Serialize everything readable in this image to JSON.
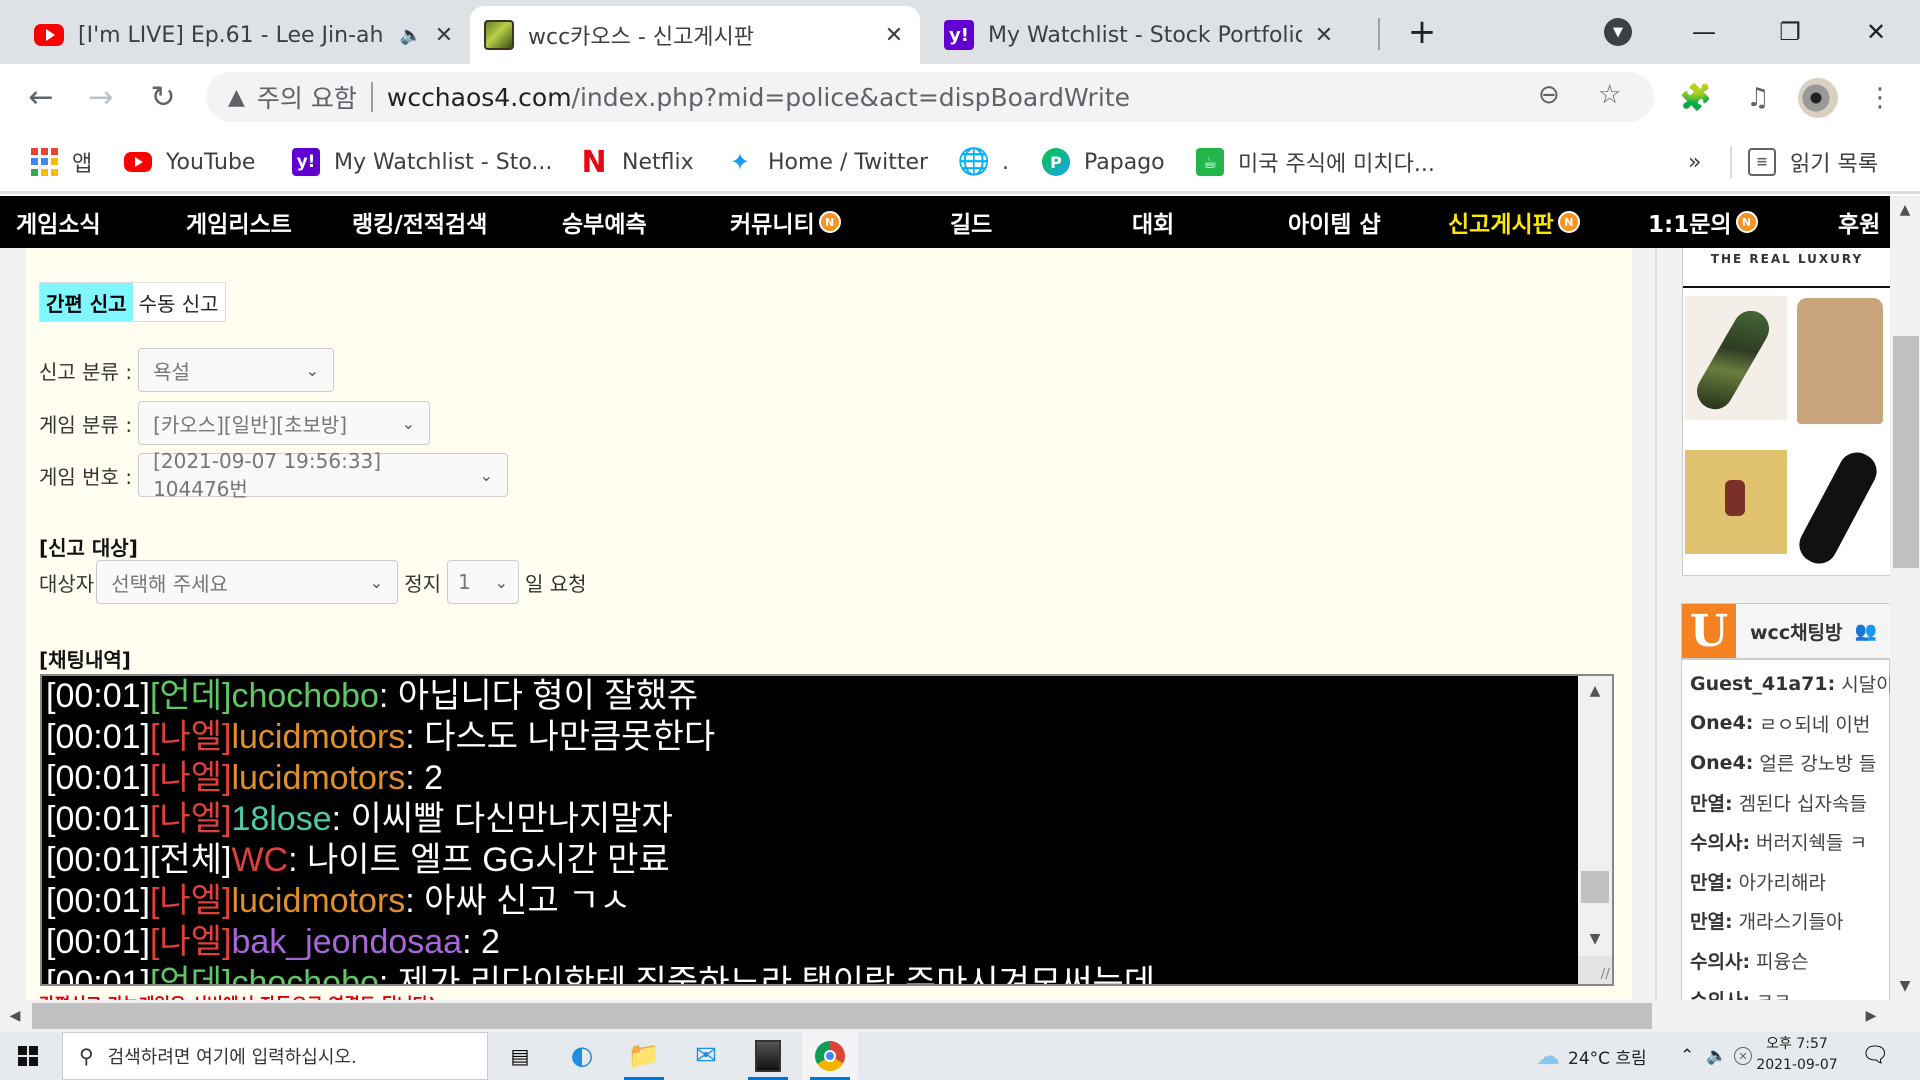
{
  "browser": {
    "tabs": [
      {
        "title": "[I'm LIVE] Ep.61 - Lee Jin-ah",
        "favicon": "youtube-icon",
        "audio": true,
        "active": false
      },
      {
        "title": "wcc카오스 - 신고게시판",
        "favicon": "orc-icon",
        "active": true
      },
      {
        "title": "My Watchlist - Stock Portfolio &",
        "favicon": "yahoo-icon",
        "active": false
      }
    ],
    "new_tab_label": "+",
    "address": {
      "security_label": "주의 요함",
      "host": "wcchaos4.com",
      "path": "/index.php?mid=police&act=dispBoardWrite"
    },
    "bookmarks": [
      {
        "label": "앱",
        "icon": "apps-grid-icon"
      },
      {
        "label": "YouTube",
        "icon": "youtube-icon"
      },
      {
        "label": "My Watchlist - Sto...",
        "icon": "yahoo-icon"
      },
      {
        "label": "Netflix",
        "icon": "netflix-icon"
      },
      {
        "label": "Home / Twitter",
        "icon": "twitter-icon"
      },
      {
        "label": ".",
        "icon": "globe-icon"
      },
      {
        "label": "Papago",
        "icon": "papago-icon"
      },
      {
        "label": "미국 주식에 미치다...",
        "icon": "cup-icon"
      }
    ],
    "bookmarks_overflow": "»",
    "reading_list_label": "읽기 목록"
  },
  "site_nav": [
    {
      "label": "게임소식",
      "badge": false
    },
    {
      "label": "게임리스트",
      "badge": false
    },
    {
      "label": "랭킹/전적검색",
      "badge": false
    },
    {
      "label": "승부예측",
      "badge": false
    },
    {
      "label": "커뮤니티",
      "badge": true
    },
    {
      "label": "길드",
      "badge": false
    },
    {
      "label": "대회",
      "badge": false
    },
    {
      "label": "아이템 샵",
      "badge": false
    },
    {
      "label": "신고게시판",
      "badge": true,
      "current": true
    },
    {
      "label": "1:1문의",
      "badge": true
    },
    {
      "label": "후원",
      "badge": false
    }
  ],
  "badge_letter": "N",
  "report_form": {
    "mode_tabs": [
      {
        "label": "간편 신고",
        "active": true
      },
      {
        "label": "수동 신고",
        "active": false
      }
    ],
    "category_label": "신고 분류 :",
    "category_value": "욕설",
    "game_type_label": "게임 분류 :",
    "game_type_value": "[카오스][일반][초보방]",
    "game_no_label": "게임 번호 :",
    "game_no_value": "[2021-09-07 19:56:33] 104476번",
    "target_section": "[신고 대상]",
    "target_label": "대상자",
    "target_placeholder": "선택해 주세요",
    "ban_label": "정지",
    "ban_days": "1",
    "ban_suffix": "일 요청",
    "chat_section": "[채팅내역]",
    "note": "간편신고 가능게임은 서버에서 자동으로 연결도 됩니다)"
  },
  "chat_log": [
    {
      "time": "[00:01]",
      "channel": "[언데]",
      "channel_color": "green",
      "user": "chochobo",
      "user_color": "green",
      "text": ": 아닙니다 형이 잘했쥬"
    },
    {
      "time": "[00:01]",
      "channel": "[나엘]",
      "channel_color": "red",
      "user": "lucidmotors",
      "user_color": "orange",
      "text": ": 다스도 나만큼못한다"
    },
    {
      "time": "[00:01]",
      "channel": "[나엘]",
      "channel_color": "red",
      "user": "lucidmotors",
      "user_color": "orange",
      "text": ": 2"
    },
    {
      "time": "[00:01]",
      "channel": "[나엘]",
      "channel_color": "red",
      "user": "18lose",
      "user_color": "teal",
      "text": ": 이씨빨 다신만나지말자"
    },
    {
      "time": "[00:01]",
      "channel": "[전체]",
      "channel_color": "white",
      "user": "WC",
      "user_color": "red",
      "text": ": 나이트 엘프 GG시간 만료"
    },
    {
      "time": "[00:01]",
      "channel": "[나엘]",
      "channel_color": "red",
      "user": "lucidmotors",
      "user_color": "orange",
      "text": ": 아싸 신고 ㄱㅅ"
    },
    {
      "time": "[00:01]",
      "channel": "[나엘]",
      "channel_color": "red",
      "user": "bak_jeondosaa",
      "user_color": "purple",
      "text": ": 2"
    },
    {
      "time": "[00:01]",
      "channel": "[언데]",
      "channel_color": "green",
      "user": "chochobo",
      "user_color": "green",
      "text": ": 제가 리다이한테 집중하느라 탭이랑 주마시겨모써는데"
    }
  ],
  "colors": {
    "green": "#5ec865",
    "red": "#e0403a",
    "white": "#ffffff",
    "orange": "#e0902a",
    "teal": "#4fc9a8",
    "purple": "#a866d8",
    "nav_highlight": "#ffe800",
    "mode_tab_active": "#80f7ff"
  },
  "sidebar": {
    "ad_brand": "THE REAL LUXURY",
    "chat_room": "wcc채팅방",
    "chat_messages": [
      {
        "user": "Guest_41a71:",
        "text": "시달이"
      },
      {
        "user": "One4:",
        "text": "ㄹㅇ되네 이번"
      },
      {
        "user": "One4:",
        "text": "얼른 강노방 들"
      },
      {
        "user": "만열:",
        "text": "겜된다 십자속들"
      },
      {
        "user": "수의사:",
        "text": "버러지쉑들 ㅋ"
      },
      {
        "user": "만열:",
        "text": "아가리해라"
      },
      {
        "user": "만열:",
        "text": "개라스기들아"
      },
      {
        "user": "수의사:",
        "text": "피융슨"
      },
      {
        "user": "수의사:",
        "text": "ㅋㅋ"
      }
    ]
  },
  "taskbar": {
    "search_placeholder": "검색하려면 여기에 입력하십시오.",
    "weather": "24°C  흐림",
    "time": "오후 7:57",
    "date": "2021-09-07"
  }
}
